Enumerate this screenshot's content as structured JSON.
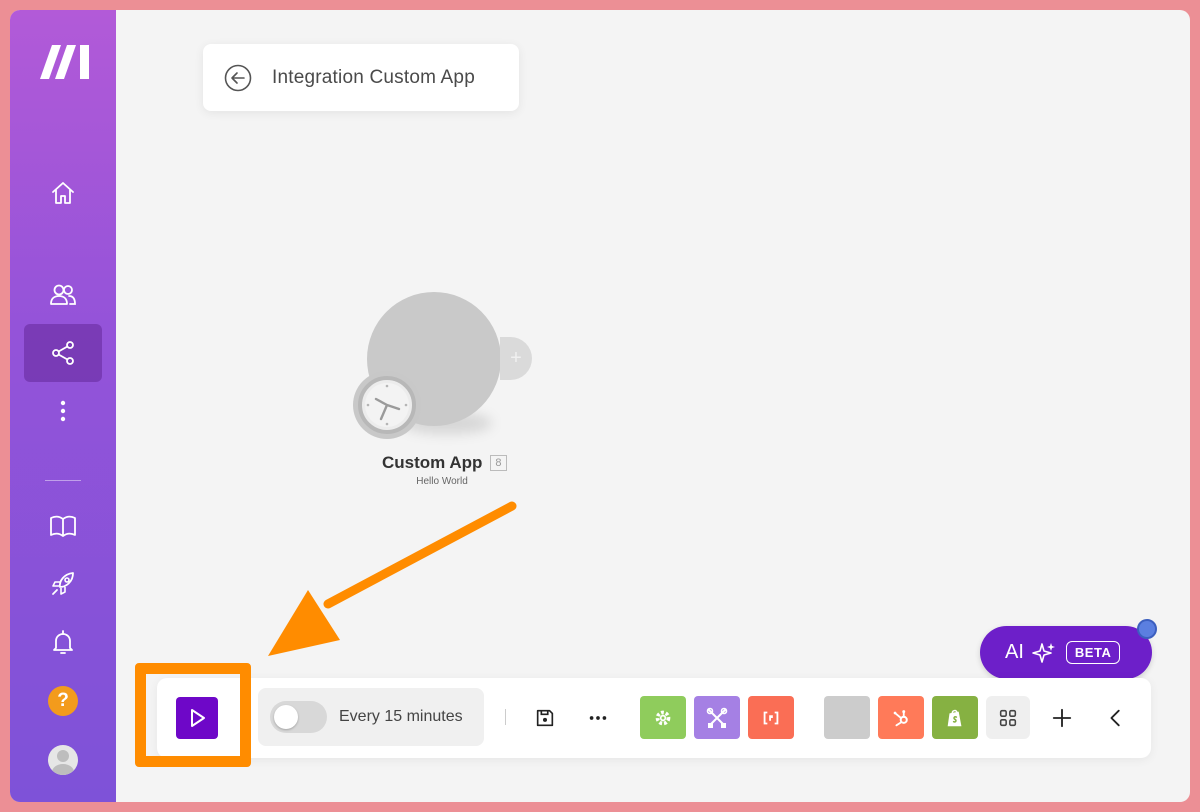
{
  "app": {
    "brand_logo": "make-logo"
  },
  "sidebar": {
    "items": [
      {
        "name": "home",
        "icon": "home-icon"
      },
      {
        "name": "team",
        "icon": "users-icon"
      },
      {
        "name": "scenarios",
        "icon": "share-icon",
        "active": true
      },
      {
        "name": "more",
        "icon": "more-vertical-icon"
      },
      {
        "name": "docs",
        "icon": "book-icon"
      },
      {
        "name": "whats-new",
        "icon": "rocket-icon"
      },
      {
        "name": "notifications",
        "icon": "bell-icon"
      },
      {
        "name": "help",
        "icon": "help-icon",
        "label": "?"
      },
      {
        "name": "profile",
        "icon": "avatar-icon"
      }
    ]
  },
  "header": {
    "title": "Integration Custom App",
    "back_icon": "arrow-left-circle-icon"
  },
  "canvas": {
    "module": {
      "name": "Custom App",
      "id": "8",
      "subtitle": "Hello World",
      "icon": "clock-icon"
    }
  },
  "ai_assistant": {
    "label": "AI",
    "badge": "BETA",
    "icon": "sparkle-icon"
  },
  "toolbar": {
    "run_icon": "play-icon",
    "schedule_text": "Every 15 minutes",
    "schedule_enabled": false,
    "tools": [
      {
        "name": "tools",
        "icon": "gear-icon",
        "color": "#8fcc5c"
      },
      {
        "name": "tools-alt",
        "icon": "wrench-cross-icon",
        "color": "#a580e4"
      },
      {
        "name": "text-parser",
        "icon": "brackets-icon",
        "color": "#fa6e55"
      },
      {
        "name": "custom",
        "icon": "blank-tile",
        "color": "#cccccc"
      },
      {
        "name": "hubspot",
        "icon": "hubspot-icon",
        "color": "#ff7a59"
      },
      {
        "name": "shopify",
        "icon": "shopify-icon",
        "color": "#86b142"
      }
    ]
  },
  "colors": {
    "accent": "#6e07c8",
    "highlight": "#ff8c00",
    "sidebar_top": "#b25ad8",
    "sidebar_bottom": "#7e52d8"
  }
}
